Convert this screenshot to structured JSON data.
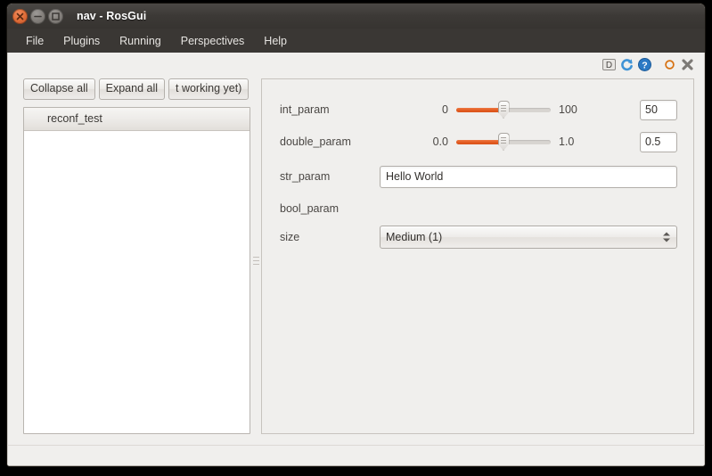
{
  "window": {
    "title": "nav - RosGui",
    "controls": [
      {
        "name": "close",
        "icon": "close-icon"
      },
      {
        "name": "minimize",
        "icon": "minimize-icon"
      },
      {
        "name": "maximize",
        "icon": "maximize-icon"
      }
    ]
  },
  "menubar": {
    "items": [
      {
        "label": "File"
      },
      {
        "label": "Plugins"
      },
      {
        "label": "Running"
      },
      {
        "label": "Perspectives"
      },
      {
        "label": "Help"
      }
    ]
  },
  "plugin_toolbar": {
    "icons": [
      {
        "name": "dock-icon",
        "glyph": "D",
        "title": "D"
      },
      {
        "name": "reload-icon",
        "glyph": "↻",
        "title": "Reload"
      },
      {
        "name": "help-icon",
        "glyph": "?",
        "title": "Help"
      },
      {
        "name": "float-icon",
        "glyph": "○",
        "title": "Float"
      },
      {
        "name": "close-plugin-icon",
        "glyph": "✖",
        "title": "Close"
      }
    ]
  },
  "left_pane": {
    "buttons": [
      {
        "label": "Collapse all"
      },
      {
        "label": "Expand all"
      },
      {
        "label": "t working yet)"
      }
    ],
    "tree": {
      "items": [
        {
          "label": "reconf_test",
          "selected": false
        }
      ]
    }
  },
  "splitter": {
    "name": "vertical-splitter",
    "grip_lines": 3
  },
  "params": {
    "rows": [
      {
        "name": "int_param",
        "label": "int_param",
        "type": "slider",
        "min_label": "0",
        "max_label": "100",
        "min": 0,
        "max": 100,
        "value": 50,
        "value_text": "50",
        "fill_percent": 50
      },
      {
        "name": "double_param",
        "label": "double_param",
        "type": "slider",
        "min_label": "0.0",
        "max_label": "1.0",
        "min": 0,
        "max": 1,
        "value": 0.5,
        "value_text": "0.5",
        "fill_percent": 50
      },
      {
        "name": "str_param",
        "label": "str_param",
        "type": "text",
        "value": "Hello World",
        "placeholder": ""
      },
      {
        "name": "bool_param",
        "label": "bool_param",
        "type": "bool",
        "value": ""
      },
      {
        "name": "size",
        "label": "size",
        "type": "combo",
        "value": "Medium (1)"
      }
    ]
  },
  "colors": {
    "accent_orange": "#e25b20",
    "titlebar": "#3c3936",
    "window_bg": "#f0efed",
    "field_bg": "#ffffff",
    "border": "#b2aea9"
  }
}
